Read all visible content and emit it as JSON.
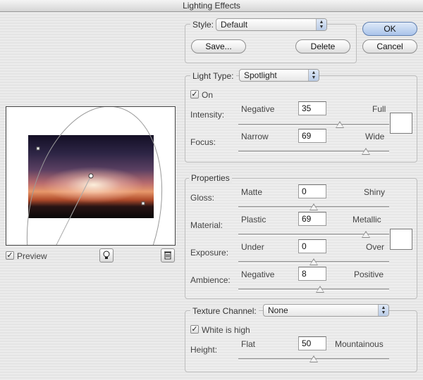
{
  "window": {
    "title": "Lighting Effects"
  },
  "style": {
    "label": "Style:",
    "value": "Default",
    "save_label": "Save...",
    "delete_label": "Delete"
  },
  "buttons": {
    "ok": "OK",
    "cancel": "Cancel"
  },
  "light_type": {
    "label": "Light Type:",
    "value": "Spotlight",
    "on_label": "On",
    "on_checked": true,
    "color": "#ffffff",
    "intensity": {
      "label": "Intensity:",
      "min_label": "Negative",
      "max_label": "Full",
      "value": "35",
      "level": 35,
      "range": [
        -100,
        100
      ]
    },
    "focus": {
      "label": "Focus:",
      "min_label": "Narrow",
      "max_label": "Wide",
      "value": "69",
      "level": 69,
      "range": [
        -100,
        100
      ]
    }
  },
  "properties": {
    "label": "Properties",
    "color": "#ffffff",
    "gloss": {
      "label": "Gloss:",
      "min_label": "Matte",
      "max_label": "Shiny",
      "value": "0",
      "level": 0,
      "range": [
        -100,
        100
      ]
    },
    "material": {
      "label": "Material:",
      "min_label": "Plastic",
      "max_label": "Metallic",
      "value": "69",
      "level": 69,
      "range": [
        -100,
        100
      ]
    },
    "exposure": {
      "label": "Exposure:",
      "min_label": "Under",
      "max_label": "Over",
      "value": "0",
      "level": 0,
      "range": [
        -100,
        100
      ]
    },
    "ambience": {
      "label": "Ambience:",
      "min_label": "Negative",
      "max_label": "Positive",
      "value": "8",
      "level": 8,
      "range": [
        -100,
        100
      ]
    }
  },
  "texture": {
    "label": "Texture Channel:",
    "value": "None",
    "white_is_high_label": "White is high",
    "white_is_high_checked": true,
    "height": {
      "label": "Height:",
      "min_label": "Flat",
      "max_label": "Mountainous",
      "value": "50",
      "level": 50,
      "range": [
        0,
        100
      ]
    }
  },
  "preview": {
    "label": "Preview",
    "checked": true
  }
}
